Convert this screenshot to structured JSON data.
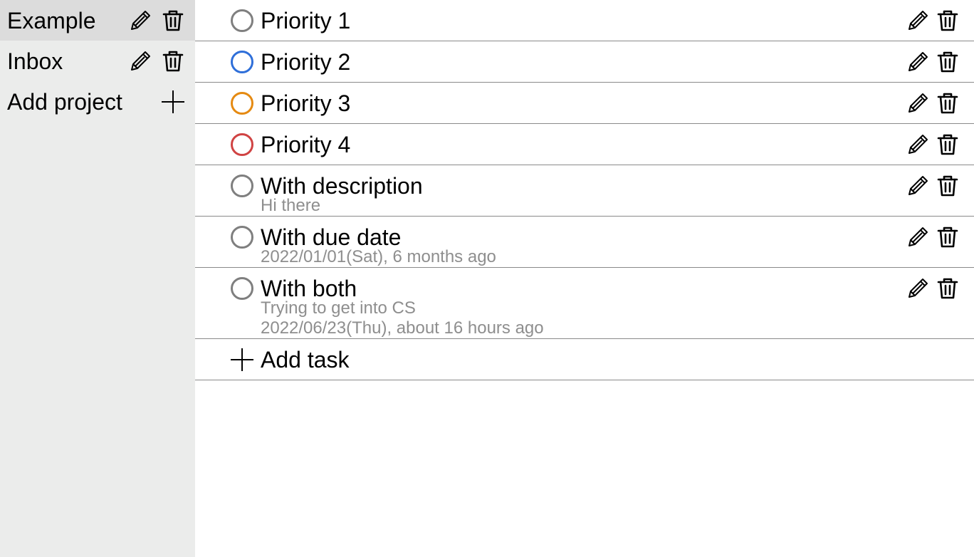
{
  "sidebar": {
    "projects": [
      {
        "name": "Example",
        "active": true
      },
      {
        "name": "Inbox",
        "active": false
      }
    ],
    "add_project_label": "Add project"
  },
  "tasks": [
    {
      "title": "Priority 1",
      "priority_color": "#7f7f7f"
    },
    {
      "title": "Priority 2",
      "priority_color": "#2f6fd9"
    },
    {
      "title": "Priority 3",
      "priority_color": "#e58a12"
    },
    {
      "title": "Priority 4",
      "priority_color": "#d04343"
    },
    {
      "title": "With description",
      "priority_color": "#7f7f7f",
      "description": "Hi there"
    },
    {
      "title": "With due date",
      "priority_color": "#7f7f7f",
      "due": "2022/01/01(Sat), 6 months ago"
    },
    {
      "title": "With both",
      "priority_color": "#7f7f7f",
      "description": "Trying to get into CS",
      "due": "2022/06/23(Thu), about 16 hours ago"
    }
  ],
  "add_task_label": "Add task",
  "icons": {
    "edit": "pencil-icon",
    "delete": "trash-icon",
    "add": "plus-icon"
  },
  "colors": {
    "sidebar_bg": "#ebeceb",
    "sidebar_active_bg": "#dcdcdc",
    "muted_text": "#8e8e8e",
    "divider": "#8a8a8a"
  }
}
